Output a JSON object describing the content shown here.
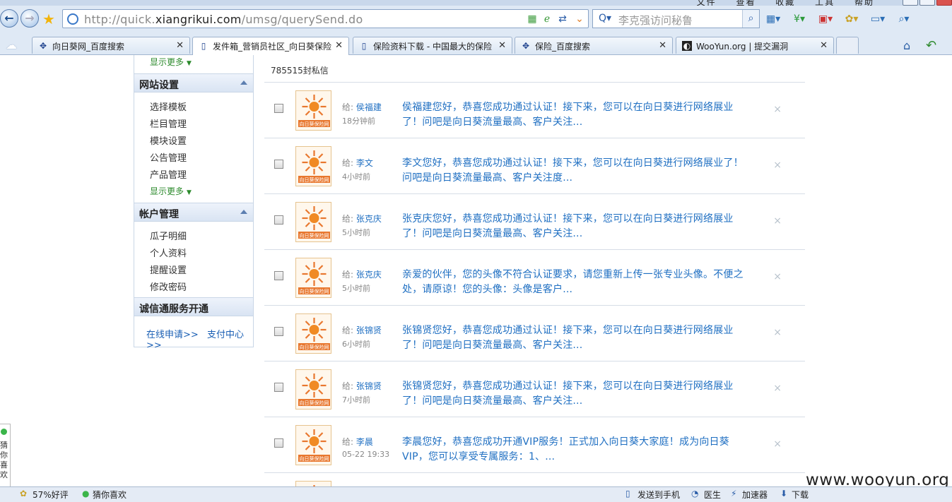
{
  "browser": {
    "menu": [
      "文件",
      "查看",
      "收藏",
      "工具",
      "帮助"
    ],
    "url_prefix": "http://quick.",
    "url_domain": "xiangrikui.com",
    "url_path": "/umsg/querySend.do",
    "search_placeholder": "李克强访问秘鲁",
    "tabs": [
      {
        "label": "向日葵网_百度搜索",
        "icon": "baidu-icon"
      },
      {
        "label": "发件箱_营销员社区_向日葵保险",
        "icon": "page-icon",
        "active": true
      },
      {
        "label": "保险资料下载 - 中国最大的保险",
        "icon": "page-icon"
      },
      {
        "label": "保险_百度搜索",
        "icon": "baidu-icon"
      },
      {
        "label": "WooYun.org | 提交漏洞",
        "icon": "wooyun-icon"
      }
    ]
  },
  "sidebar": {
    "more_label": "显示更多",
    "site_settings": {
      "title": "网站设置",
      "items": [
        "选择模板",
        "栏目管理",
        "模块设置",
        "公告管理",
        "产品管理"
      ]
    },
    "account": {
      "title": "帐户管理",
      "items": [
        "瓜子明细",
        "个人资料",
        "提醒设置",
        "修改密码"
      ]
    },
    "credit": {
      "title": "诚信通服务开通",
      "apply": "在线申请>>",
      "pay": "支付中心>>"
    }
  },
  "main": {
    "count_text": "785515封私信",
    "to_label": "给:",
    "logo_text": "向日葵保险网",
    "messages": [
      {
        "to": "侯福建",
        "time": "18分钟前",
        "text": "侯福建您好，恭喜您成功通过认证！接下来，您可以在向日葵进行网络展业了！问吧是向日葵流量最高、客户关注..."
      },
      {
        "to": "李文",
        "time": "4小时前",
        "text": "李文您好，恭喜您成功通过认证！接下来，您可以在向日葵进行网络展业了！问吧是向日葵流量最高、客户关注度..."
      },
      {
        "to": "张克庆",
        "time": "5小时前",
        "text": "张克庆您好，恭喜您成功通过认证！接下来，您可以在向日葵进行网络展业了！问吧是向日葵流量最高、客户关注..."
      },
      {
        "to": "张克庆",
        "time": "5小时前",
        "text": "亲爱的伙伴，您的头像不符合认证要求，请您重新上传一张专业头像。不便之处，请原谅！您的头像：头像是客户..."
      },
      {
        "to": "张锦贤",
        "time": "6小时前",
        "text": "张锦贤您好，恭喜您成功通过认证！接下来，您可以在向日葵进行网络展业了！问吧是向日葵流量最高、客户关注..."
      },
      {
        "to": "张锦贤",
        "time": "7小时前",
        "text": "张锦贤您好，恭喜您成功通过认证！接下来，您可以在向日葵进行网络展业了！问吧是向日葵流量最高、客户关注..."
      },
      {
        "to": "李晨",
        "time": "05-22 19:33",
        "text": "李晨您好，恭喜您成功开通VIP服务！正式加入向日葵大家庭！成为向日葵VIP，您可以享受专属服务：1、..."
      }
    ],
    "delete_glyph": "×"
  },
  "popup": {
    "text": "猜你喜欢"
  },
  "statusbar": {
    "rating": "57%好评",
    "guess": "猜你喜欢",
    "send_phone": "发送到手机",
    "doctor": "医生",
    "accel": "加速器",
    "download": "下载"
  },
  "watermark": "www.wooyun.org"
}
